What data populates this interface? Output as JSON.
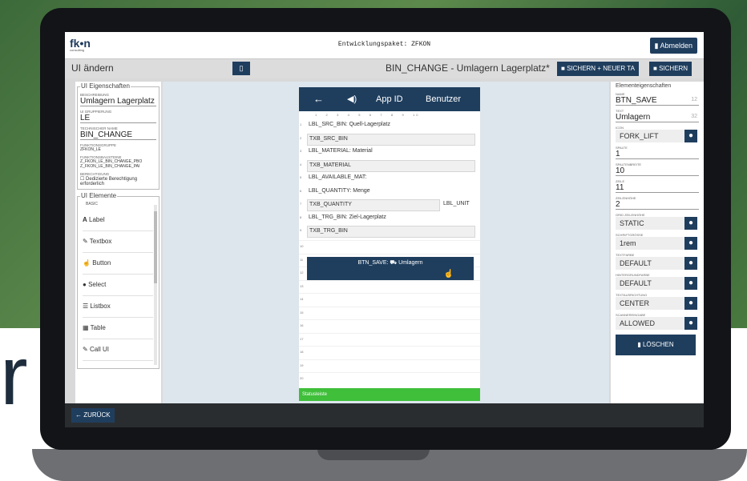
{
  "topbar": {
    "logo": "fk•n",
    "logo_sub": "consulting",
    "package": "Entwicklungspaket: ZFKON",
    "logout": "Abmelden"
  },
  "titlebar": {
    "left": "UI ändern",
    "center": "BIN_CHANGE - Umlagern Lagerplatz*",
    "save_new": "SICHERN + NEUER TA",
    "save": "SICHERN"
  },
  "left": {
    "legend": "UI Eigenschaften",
    "fields": [
      {
        "label": "BESCHREIBUNG",
        "value": "Umlagern Lagerplatz"
      },
      {
        "label": "UI GRUPPIERUNG",
        "value": "LE"
      },
      {
        "label": "TECHNISCHER NAME",
        "value": "BIN_CHANGE"
      }
    ],
    "fg_label": "FUNKTIONSGRUPPE",
    "fg_value": "ZFKON_LE",
    "fb_label": "FUNKTIONSBAUSTEINE",
    "fb_value1": "Z_FKON_LE_BIN_CHANGE_PBO",
    "fb_value2": "Z_FKON_LE_BIN_CHANGE_PAI",
    "auth_label": "BERECHTIGUNG",
    "auth_text": "Dedizierte Berechtigung erforderlich",
    "ui_legend": "UI Elemente",
    "basic": "BASIC",
    "items": [
      "Label",
      "Textbox",
      "Button",
      "Select",
      "Listbox",
      "Table",
      "Call UI"
    ]
  },
  "phone": {
    "app_id": "App ID",
    "user": "Benutzer",
    "cols": "1   2   3   4   5   6   7   8   9   10",
    "rows": [
      {
        "n": "1",
        "text": "LBL_SRC_BIN:  Quell-Lagerplatz",
        "type": "label"
      },
      {
        "n": "2",
        "text": "TXB_SRC_BIN",
        "type": "txb"
      },
      {
        "n": "3",
        "text": "LBL_MATERIAL:  Material",
        "type": "label"
      },
      {
        "n": "4",
        "text": "TXB_MATERIAL",
        "type": "txb"
      },
      {
        "n": "5",
        "text": "LBL_AVAILABLE_MAT:",
        "type": "label"
      },
      {
        "n": "6",
        "text": "LBL_QUANTITY:  Menge",
        "type": "label"
      },
      {
        "n": "7",
        "text": "TXB_QUANTITY",
        "type": "txbunit",
        "unit": "LBL_UNIT"
      },
      {
        "n": "8",
        "text": "LBL_TRG_BIN:  Ziel-Lagerplatz",
        "type": "label"
      },
      {
        "n": "9",
        "text": "TXB_TRG_BIN",
        "type": "txb"
      }
    ],
    "empty_rows": [
      "10",
      "11",
      "12",
      "13",
      "14",
      "15",
      "16",
      "17",
      "18",
      "19",
      "20"
    ],
    "button": "BTN_SAVE: ⛟ Umlagern",
    "status": "Statusleiste"
  },
  "right": {
    "title": "Elementeigenschaften",
    "name_label": "NAME",
    "name": "BTN_SAVE",
    "name_count": "12",
    "text_label": "TEXT",
    "text": "Umlagern",
    "text_count": "32",
    "icon_label": "ICON",
    "icon": "FORK_LIFT",
    "col_label": "SPALTE",
    "col": "1",
    "width_label": "SPALTENBREITE",
    "width": "10",
    "row_label": "ZEILE",
    "row": "11",
    "height_label": "ZEILENHÖHE",
    "height": "2",
    "gridh_label": "GRID ZEILENHÖHE",
    "gridh": "STATIC",
    "font_label": "SCHRIFTGRÖSSE",
    "font": "1rem",
    "color_label": "TEXTFARBE",
    "color": "DEFAULT",
    "bg_label": "HINTERGRUNDFARBE",
    "bg": "DEFAULT",
    "align_label": "TEXTAUSRICHTUNG",
    "align": "CENTER",
    "scan_label": "SCANNEREINGABE",
    "scan": "ALLOWED",
    "delete": "LÖSCHEN"
  },
  "bottom": {
    "back": "← ZURÜCK"
  },
  "bg_letter": "r"
}
